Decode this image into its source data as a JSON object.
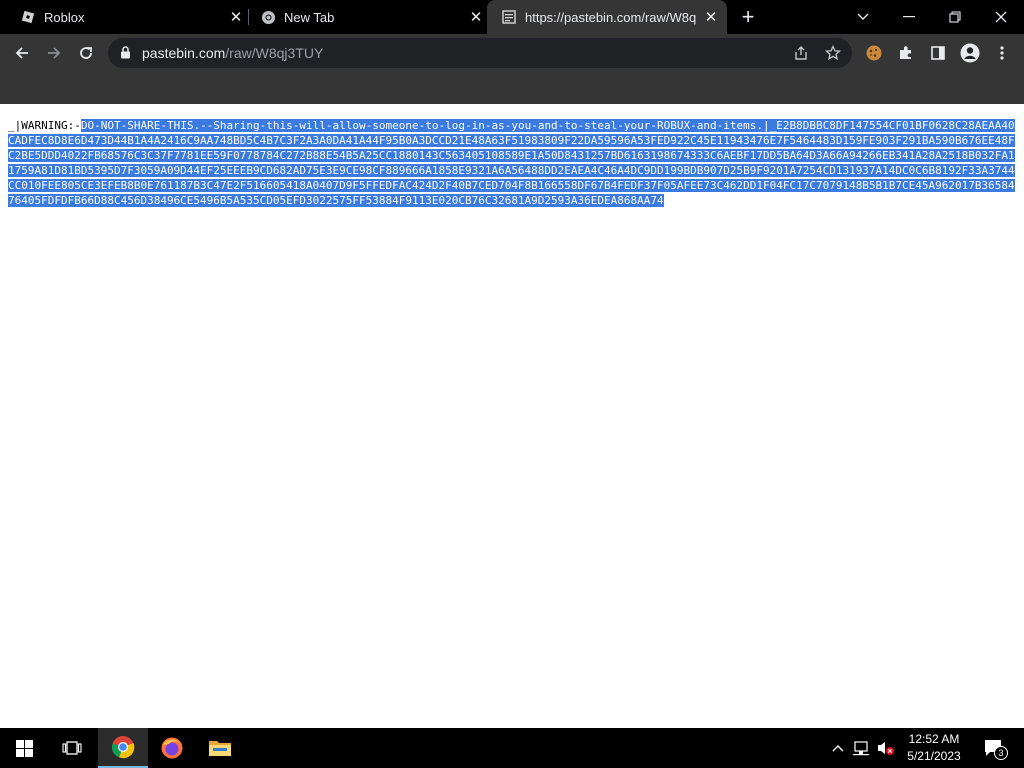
{
  "tabs": [
    {
      "title": "Roblox",
      "favicon": "roblox-icon",
      "active": false
    },
    {
      "title": "New Tab",
      "favicon": "chrome-icon",
      "active": false
    },
    {
      "title": "https://pastebin.com/raw/W8q",
      "favicon": "pastebin-icon",
      "active": true
    }
  ],
  "omnibox": {
    "host": "pastebin.com",
    "path": "/raw/W8qj3TUY"
  },
  "page": {
    "prefix": "_|WARNING:-",
    "selected": "DO-NOT-SHARE-THIS.--Sharing-this-will-allow-someone-to-log-in-as-you-and-to-steal-your-ROBUX-and-items.|_E2B8DBBC8DF147554CF01BF0628C28AEAA40CADFEC8D8E6D473D44B1A4A2416C9AA748BD5C4B7C3F2A3A0DA41A44F95B0A3DCCD21E48A63F51983809F22DA59596A53FED922C45E11943476E7F5464483D159FE903F291BA590B676EE48FC2BE5DDD4022FB68576C3C37F7781EE59F0778784C272B88E54B5A25CC1880143C563405108589E1A50D8431257BD6163198674333C6AEBF17DD5BA64D3A66A94266EB341A28A2518B032FA11759A81D81BD5395D7F3059A09D44EF25EEEB9CD682AD75E3E9CE98CF889666A1858E9321A6A56488DD2EAEA4C46A4DC9DD199BDB907D25B9F9201A7254CD131937A14DC0C6B8192F33A3744CC010FEE805CE3EFEB8B0E761187B3C47E2F516605418A0407D9F5FFEDFAC424D2F40B7CED704F8B166558DF67B4FEDF37F05AFEE73C462DD1F04FC17C7079148B5B1B7CE45A962017B3658476405FDFDFB66D88C456D38496CE5496B5A535CD05EFD3022575FF53884F9113E020CB76C32681A9D2593A36EDEA868AA74"
  },
  "taskbar": {
    "time": "12:52 AM",
    "date": "5/21/2023",
    "notifications": "3"
  },
  "colors": {
    "selection": "#3b7be0",
    "chrome_dark": "#353535",
    "tab_strip": "#000000"
  }
}
